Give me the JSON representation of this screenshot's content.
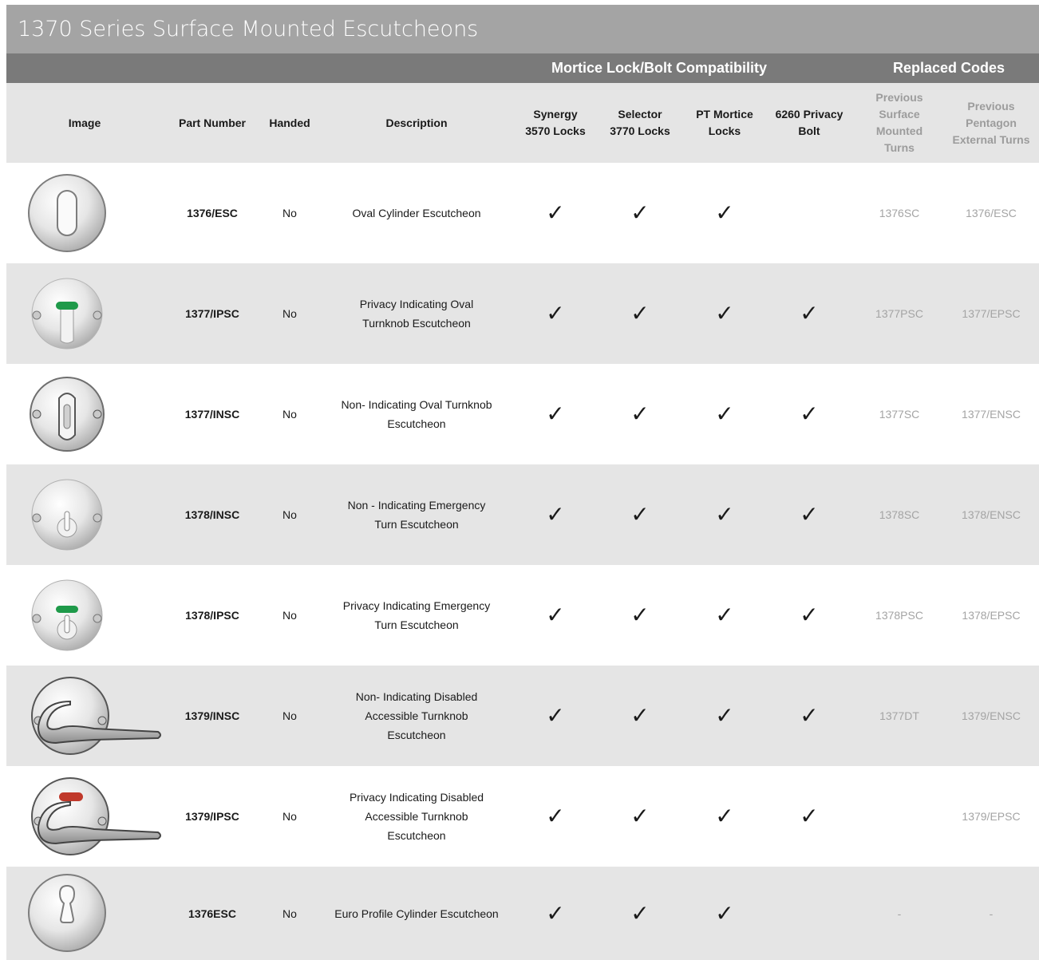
{
  "title": "1370 Series Surface Mounted Escutcheons",
  "groups": {
    "compatibility": "Mortice Lock/Bolt Compatibility",
    "replaced": "Replaced Codes"
  },
  "headers": {
    "image": "Image",
    "part_number": "Part Number",
    "handed": "Handed",
    "description": "Description",
    "synergy": "Synergy\n3570 Locks",
    "selector": "Selector\n3770 Locks",
    "pt_mortice": "PT Mortice\nLocks",
    "privacy_bolt": "6260 Privacy\nBolt",
    "prev_surface": "Previous\nSurface\nMounted\nTurns",
    "prev_pentagon": "Previous\nPentagon\nExternal Turns"
  },
  "check_mark": "✓",
  "colors": {
    "title_bg": "#a4a4a4",
    "group_bg": "#7a7a7a",
    "stripe": "#e5e5e5",
    "indicator_green": "#1f9a4a",
    "indicator_red": "#c0392b"
  },
  "rows": [
    {
      "image_icon": "oval-cylinder-escutcheon-icon",
      "part": "1376/ESC",
      "handed": "No",
      "description": "Oval Cylinder Escutcheon",
      "synergy": "✓",
      "selector": "✓",
      "pt": "✓",
      "bolt": "",
      "prev_surface": "1376SC",
      "prev_pentagon": "1376/ESC"
    },
    {
      "image_icon": "privacy-indicating-turnknob-icon",
      "part": "1377/IPSC",
      "handed": "No",
      "description": "Privacy Indicating Oval\nTurnknob Escutcheon",
      "synergy": "✓",
      "selector": "✓",
      "pt": "✓",
      "bolt": "✓",
      "prev_surface": "1377PSC",
      "prev_pentagon": "1377/EPSC"
    },
    {
      "image_icon": "non-indicating-turnknob-icon",
      "part": "1377/INSC",
      "handed": "No",
      "description": "Non- Indicating Oval Turnknob\nEscutcheon",
      "synergy": "✓",
      "selector": "✓",
      "pt": "✓",
      "bolt": "✓",
      "prev_surface": "1377SC",
      "prev_pentagon": "1377/ENSC"
    },
    {
      "image_icon": "non-indicating-emergency-turn-icon",
      "part": "1378/INSC",
      "handed": "No",
      "description": "Non - Indicating Emergency\nTurn Escutcheon",
      "synergy": "✓",
      "selector": "✓",
      "pt": "✓",
      "bolt": "✓",
      "prev_surface": "1378SC",
      "prev_pentagon": "1378/ENSC"
    },
    {
      "image_icon": "privacy-indicating-emergency-turn-icon",
      "part": "1378/IPSC",
      "handed": "No",
      "description": "Privacy Indicating Emergency\nTurn Escutcheon",
      "synergy": "✓",
      "selector": "✓",
      "pt": "✓",
      "bolt": "✓",
      "prev_surface": "1378PSC",
      "prev_pentagon": "1378/EPSC"
    },
    {
      "image_icon": "non-indicating-disabled-turnknob-icon",
      "part": "1379/INSC",
      "handed": "No",
      "description": "Non- Indicating Disabled\nAccessible Turnknob\nEscutcheon",
      "synergy": "✓",
      "selector": "✓",
      "pt": "✓",
      "bolt": "✓",
      "prev_surface": "1377DT",
      "prev_pentagon": "1379/ENSC"
    },
    {
      "image_icon": "privacy-indicating-disabled-turnknob-icon",
      "part": "1379/IPSC",
      "handed": "No",
      "description": "Privacy Indicating Disabled\nAccessible Turnknob\nEscutcheon",
      "synergy": "✓",
      "selector": "✓",
      "pt": "✓",
      "bolt": "✓",
      "prev_surface": "",
      "prev_pentagon": "1379/EPSC"
    },
    {
      "image_icon": "euro-profile-cylinder-escutcheon-icon",
      "part": "1376ESC",
      "handed": "No",
      "description": "Euro Profile Cylinder Escutcheon",
      "synergy": "✓",
      "selector": "✓",
      "pt": "✓",
      "bolt": "",
      "prev_surface": "-",
      "prev_pentagon": "-"
    }
  ]
}
